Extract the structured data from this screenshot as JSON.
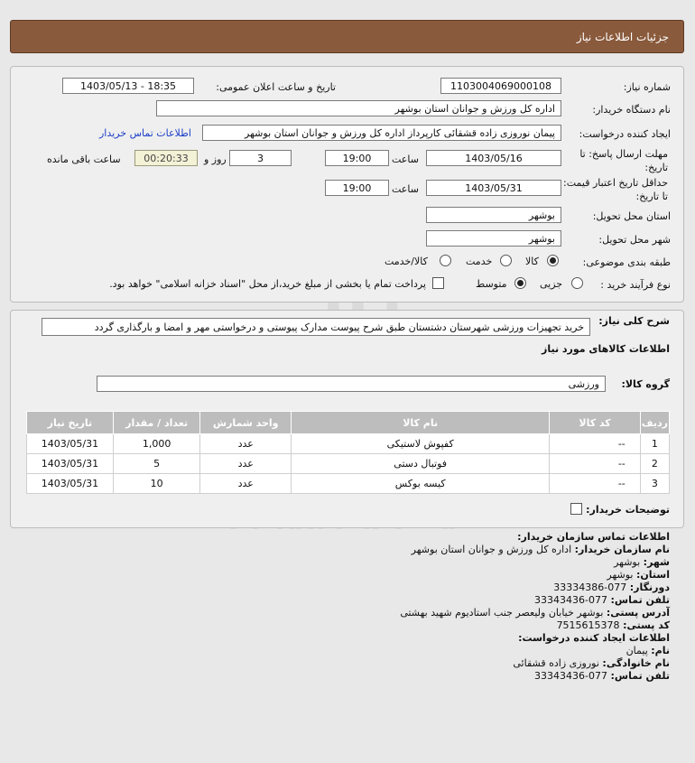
{
  "header": {
    "title": "جزئیات اطلاعات نیاز"
  },
  "form": {
    "need_number": {
      "label": "شماره نیاز:",
      "value": "1103004069000108"
    },
    "announce": {
      "label": "تاریخ و ساعت اعلان عمومی:",
      "value": "1403/05/13 - 18:35"
    },
    "buyer_org": {
      "label": "نام دستگاه خریدار:",
      "value": "اداره کل ورزش و جوانان استان بوشهر"
    },
    "creator": {
      "label": "ایجاد کننده درخواست:",
      "value": "پیمان نوروزی زاده قشقائی کارپرداز اداره کل ورزش و جوانان استان بوشهر",
      "contact_link": "اطلاعات تماس خریدار"
    },
    "deadline": {
      "label": "مهلت ارسال پاسخ: تا تاریخ:",
      "date": "1403/05/16",
      "time_label": "ساعت",
      "time": "19:00",
      "days": "3",
      "days_label": "روز و",
      "remaining": "00:20:33",
      "remaining_label": "ساعت باقی مانده"
    },
    "validity": {
      "label": "حداقل تاریخ اعتبار قیمت: تا تاریخ:",
      "date": "1403/05/31",
      "time_label": "ساعت",
      "time": "19:00"
    },
    "delivery_province": {
      "label": "استان محل تحویل:",
      "value": "بوشهر"
    },
    "delivery_city": {
      "label": "شهر محل تحویل:",
      "value": "بوشهر"
    },
    "category": {
      "label": "طبقه بندی موضوعی:",
      "options": [
        "کالا",
        "خدمت",
        "کالا/خدمت"
      ],
      "selected": "کالا"
    },
    "process": {
      "label": "نوع فرآیند خرید :",
      "options": [
        "جزیی",
        "متوسط"
      ],
      "selected": "متوسط",
      "payment_note": "پرداخت تمام یا بخشی از مبلغ خرید،از محل \"اسناد خزانه اسلامی\" خواهد بود."
    }
  },
  "description": {
    "label": "شرح کلی نیاز:",
    "value": "خرید تجهیزات ورزشی شهرستان دشتستان طبق شرح پیوست مدارک پیوستی و درخواستی مهر و امضا و بارگذاری گردد"
  },
  "goods": {
    "section_title": "اطلاعات کالاهای مورد نیاز",
    "group_label": "گروه کالا:",
    "group_value": "ورزشی",
    "columns": [
      "ردیف",
      "کد کالا",
      "نام کالا",
      "واحد شمارش",
      "تعداد / مقدار",
      "تاریخ نیاز"
    ],
    "rows": [
      [
        "1",
        "--",
        "کفپوش لاستیکی",
        "عدد",
        "1,000",
        "1403/05/31"
      ],
      [
        "2",
        "--",
        "فوتبال دستی",
        "عدد",
        "5",
        "1403/05/31"
      ],
      [
        "3",
        "--",
        "کیسه بوکس",
        "عدد",
        "10",
        "1403/05/31"
      ]
    ],
    "buyer_notes_label": "توضیحات خریدار:"
  },
  "contact": {
    "title": "اطلاعات تماس سازمان خریدار:",
    "org_label": "نام سازمان خریدار:",
    "org": "اداره کل ورزش و جوانان استان بوشهر",
    "city_label": "شهر:",
    "city": "بوشهر",
    "province_label": "استان:",
    "province": "بوشهر",
    "fax_label": "دورنگار:",
    "fax": "077-33334386",
    "phone_label": "تلفن تماس:",
    "phone": "077-33343436",
    "address_label": "آدرس پستی:",
    "address": "بوشهر خیابان ولیعصر جنب استادیوم شهید بهشتی",
    "postal_label": "کد پستی:",
    "postal": "7515615378",
    "creator_title": "اطلاعات ایجاد کننده درخواست:",
    "first_name_label": "نام:",
    "first_name": "پیمان",
    "last_name_label": "نام خانوادگی:",
    "last_name": "نوروزی زاده قشقائی",
    "creator_phone_label": "تلفن تماس:",
    "creator_phone": "077-33343436"
  },
  "watermark": {
    "brand": "ParsNamadData",
    "line1": "مرکز فراوری اطلاعات پارس نماد داده ها",
    "line2": "پایگاه اطلاع رسانی مناقصه و مزایده",
    "phone": "۰۲۱-۸۸۳۴۹۶۷۰-۵",
    "logo_digits": "010101"
  }
}
